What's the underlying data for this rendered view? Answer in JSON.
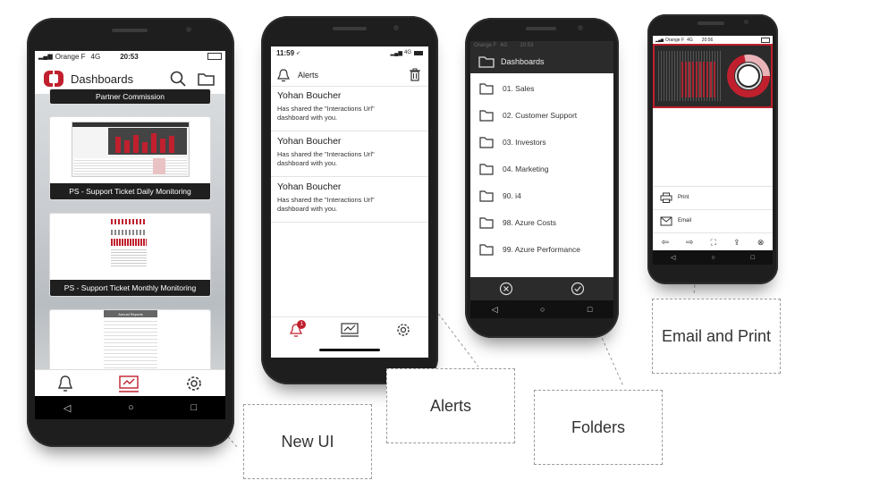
{
  "phone1": {
    "status": {
      "carrier": "Orange F",
      "network": "4G",
      "time": "20:53"
    },
    "header": {
      "title": "Dashboards"
    },
    "partial_caption": "Partner Commission",
    "cards": [
      {
        "caption": "PS - Support Ticket Daily Monitoring"
      },
      {
        "caption": "PS - Support Ticket Monthly Monitoring"
      }
    ],
    "third_card_header": "Annual Reports"
  },
  "phone2": {
    "status": {
      "time": "11:59",
      "network": "4G"
    },
    "header": {
      "title": "Alerts"
    },
    "alerts": [
      {
        "name": "Yohan Boucher",
        "message": "Has shared the \"Interactions Url\" dashboard with you."
      },
      {
        "name": "Yohan Boucher",
        "message": "Has shared the \"Interactions Url\" dashboard with you."
      },
      {
        "name": "Yohan Boucher",
        "message": "Has shared the \"Interactions Url\" dashboard with you."
      }
    ],
    "badge_count": "1"
  },
  "phone3": {
    "status": {
      "carrier": "Orange F",
      "network": "4G",
      "time": "20:53"
    },
    "header": {
      "title": "Dashboards"
    },
    "folders": [
      {
        "label": "01. Sales"
      },
      {
        "label": "02. Customer Support"
      },
      {
        "label": "03. Investors"
      },
      {
        "label": "04. Marketing"
      },
      {
        "label": "90. i4"
      },
      {
        "label": "98. Azure Costs"
      },
      {
        "label": "99. Azure Performance"
      }
    ]
  },
  "phone4": {
    "status": {
      "carrier": "Orange F",
      "network": "4G",
      "time": "20:56"
    },
    "menu": {
      "print": "Print",
      "email": "Email"
    }
  },
  "callouts": {
    "new_ui": "New UI",
    "alerts": "Alerts",
    "folders": "Folders",
    "email_print": "Email and Print"
  },
  "colors": {
    "brand_red": "#c0202e",
    "dark_bar": "#2b2b2b",
    "callout_border": "#9a9a9a"
  }
}
